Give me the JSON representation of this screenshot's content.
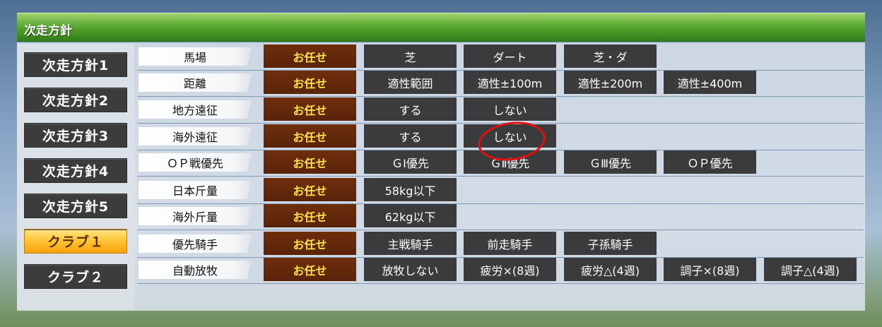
{
  "window": {
    "title": "次走方針"
  },
  "sidebar": {
    "items": [
      {
        "label": "次走方針1"
      },
      {
        "label": "次走方針2"
      },
      {
        "label": "次走方針3"
      },
      {
        "label": "次走方針4"
      },
      {
        "label": "次走方針5"
      },
      {
        "label": "クラブ１",
        "selected": true
      },
      {
        "label": "クラブ２"
      }
    ]
  },
  "rows": [
    {
      "label": "馬場",
      "options": [
        "お任せ",
        "芝",
        "ダート",
        "芝・ダ"
      ]
    },
    {
      "label": "距離",
      "options": [
        "お任せ",
        "適性範囲",
        "適性±100m",
        "適性±200m",
        "適性±400m"
      ]
    },
    {
      "label": "地方遠征",
      "options": [
        "お任せ",
        "する",
        "しない"
      ]
    },
    {
      "label": "海外遠征",
      "options": [
        "お任せ",
        "する",
        "しない"
      ]
    },
    {
      "label": "ＯＰ戦優先",
      "options": [
        "お任せ",
        "ＧⅠ優先",
        "ＧⅡ優先",
        "ＧⅢ優先",
        "ＯＰ優先"
      ]
    },
    {
      "label": "日本斤量",
      "options": [
        "お任せ",
        "58kg以下"
      ]
    },
    {
      "label": "海外斤量",
      "options": [
        "お任せ",
        "62kg以下"
      ]
    },
    {
      "label": "優先騎手",
      "options": [
        "お任せ",
        "主戦騎手",
        "前走騎手",
        "子孫騎手"
      ]
    },
    {
      "label": "自動放牧",
      "options": [
        "お任せ",
        "放牧しない",
        "疲労×(8週)",
        "疲労△(4週)",
        "調子×(8週)",
        "調子△(4週)"
      ]
    }
  ],
  "selected_option_color": "#ffe14a",
  "annotation": {
    "type": "red-circle",
    "row": 3,
    "option": 2,
    "color": "#e01010"
  }
}
